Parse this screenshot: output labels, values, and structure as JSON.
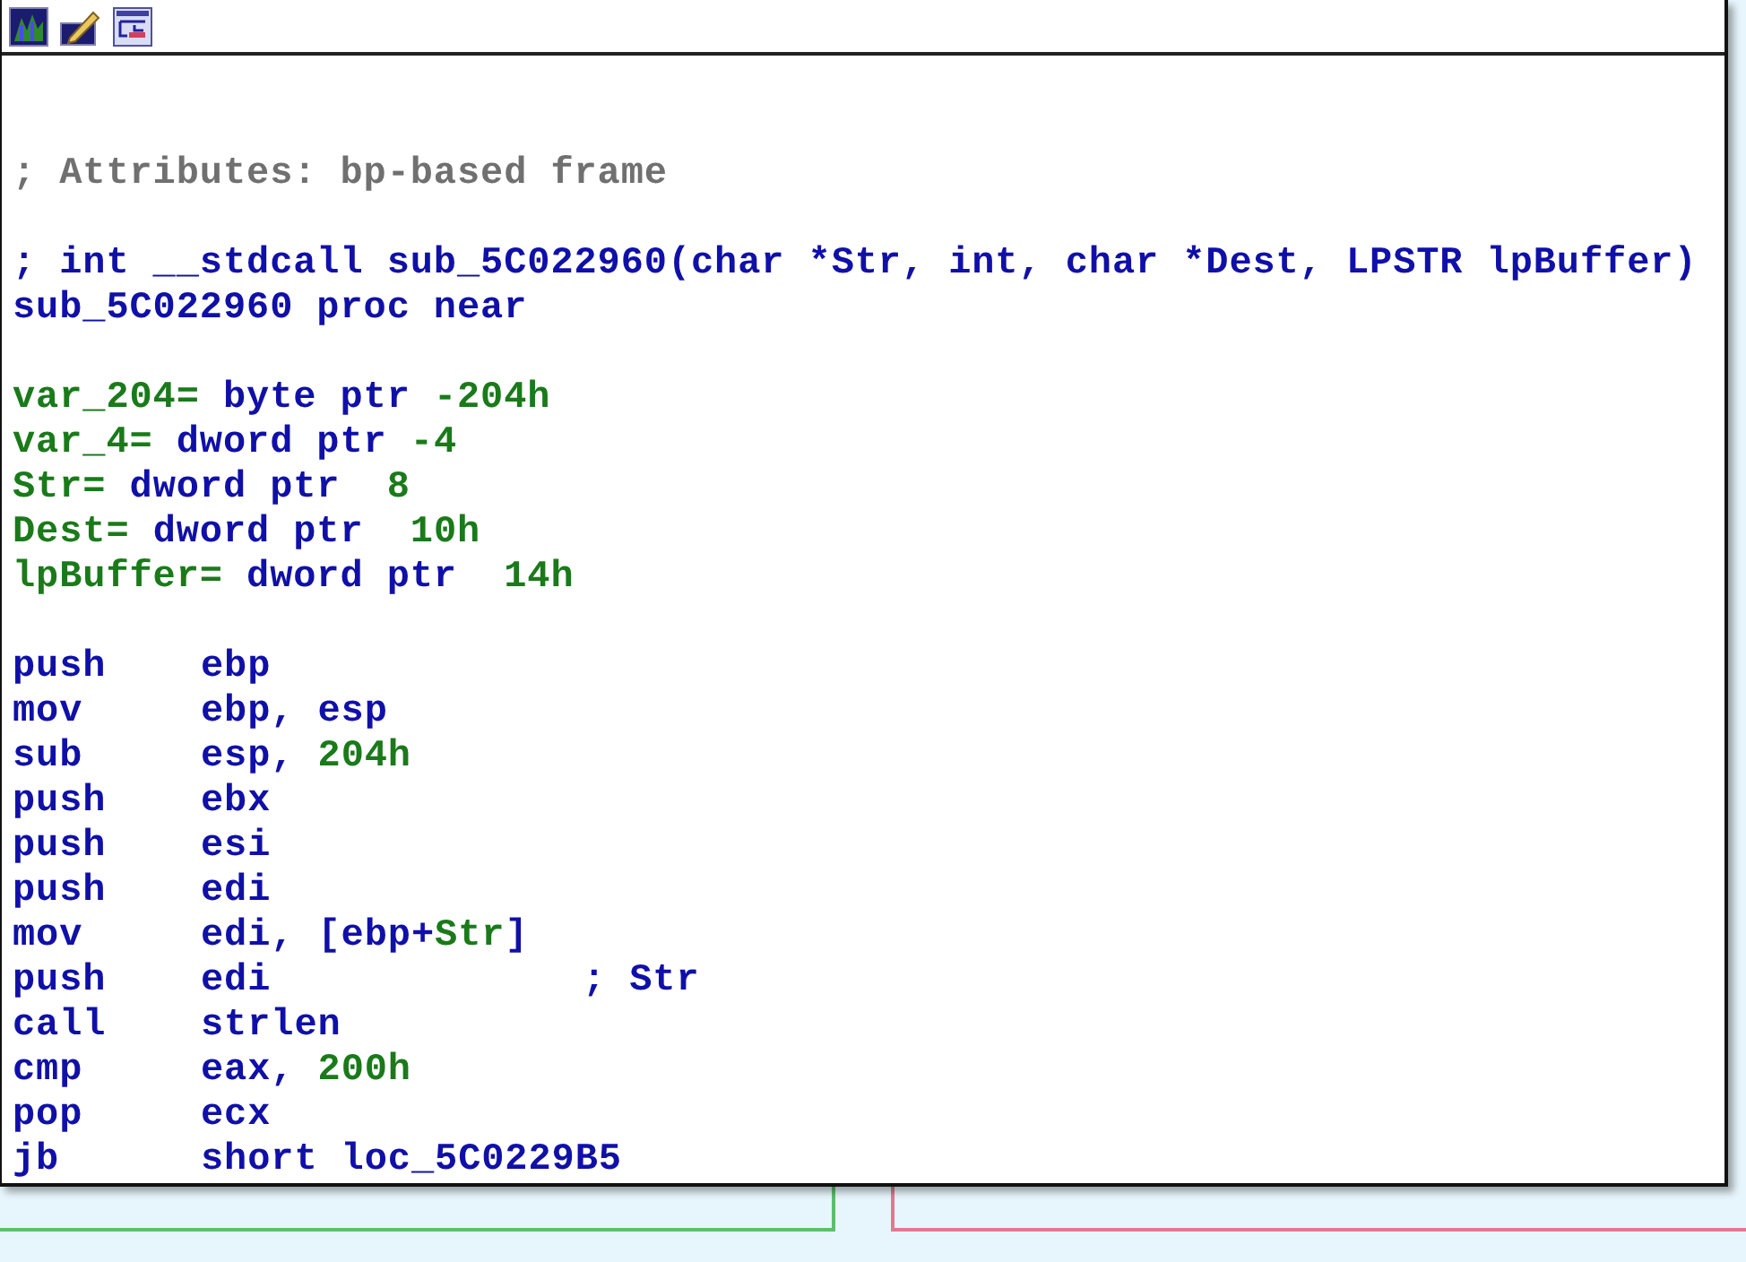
{
  "listing": [
    {
      "kind": "blank"
    },
    {
      "kind": "blank"
    },
    {
      "kind": "text",
      "segments": [
        {
          "text": "; Attributes: bp-based frame",
          "kind": "comment"
        }
      ]
    },
    {
      "kind": "blank"
    },
    {
      "kind": "text",
      "segments": [
        {
          "text": "; int __stdcall sub_5C022960(char *Str, int, char *Dest, LPSTR lpBuffer)",
          "kind": "code"
        }
      ]
    },
    {
      "kind": "text",
      "segments": [
        {
          "text": "sub_5C022960 proc near",
          "kind": "code"
        }
      ]
    },
    {
      "kind": "blank"
    },
    {
      "kind": "text",
      "segments": [
        {
          "text": "var_204=",
          "kind": "data"
        },
        {
          "text": " byte ptr ",
          "kind": "code"
        },
        {
          "text": "-204h",
          "kind": "data"
        }
      ]
    },
    {
      "kind": "text",
      "segments": [
        {
          "text": "var_4=",
          "kind": "data"
        },
        {
          "text": " dword ptr ",
          "kind": "code"
        },
        {
          "text": "-4",
          "kind": "data"
        }
      ]
    },
    {
      "kind": "text",
      "segments": [
        {
          "text": "Str=",
          "kind": "data"
        },
        {
          "text": " dword ptr  ",
          "kind": "code"
        },
        {
          "text": "8",
          "kind": "data"
        }
      ]
    },
    {
      "kind": "text",
      "segments": [
        {
          "text": "Dest=",
          "kind": "data"
        },
        {
          "text": " dword ptr  ",
          "kind": "code"
        },
        {
          "text": "10h",
          "kind": "data"
        }
      ]
    },
    {
      "kind": "text",
      "segments": [
        {
          "text": "lpBuffer=",
          "kind": "data"
        },
        {
          "text": " dword ptr  ",
          "kind": "code"
        },
        {
          "text": "14h",
          "kind": "data"
        }
      ]
    },
    {
      "kind": "blank"
    },
    {
      "kind": "instruction",
      "mnemonic": "push",
      "operands": [
        {
          "text": "ebp",
          "kind": "code"
        }
      ]
    },
    {
      "kind": "instruction",
      "mnemonic": "mov",
      "operands": [
        {
          "text": "ebp, esp",
          "kind": "code"
        }
      ]
    },
    {
      "kind": "instruction",
      "mnemonic": "sub",
      "operands": [
        {
          "text": "esp, ",
          "kind": "code"
        },
        {
          "text": "204h",
          "kind": "data"
        }
      ]
    },
    {
      "kind": "instruction",
      "mnemonic": "push",
      "operands": [
        {
          "text": "ebx",
          "kind": "code"
        }
      ]
    },
    {
      "kind": "instruction",
      "mnemonic": "push",
      "operands": [
        {
          "text": "esi",
          "kind": "code"
        }
      ]
    },
    {
      "kind": "instruction",
      "mnemonic": "push",
      "operands": [
        {
          "text": "edi",
          "kind": "code"
        }
      ]
    },
    {
      "kind": "instruction",
      "mnemonic": "mov",
      "operands": [
        {
          "text": "edi, [ebp+",
          "kind": "code"
        },
        {
          "text": "Str",
          "kind": "data"
        },
        {
          "text": "]",
          "kind": "code"
        }
      ]
    },
    {
      "kind": "instruction",
      "mnemonic": "push",
      "operands": [
        {
          "text": "edi",
          "kind": "code"
        }
      ],
      "comment": "; Str"
    },
    {
      "kind": "instruction",
      "mnemonic": "call",
      "operands": [
        {
          "text": "strlen",
          "kind": "code"
        }
      ]
    },
    {
      "kind": "instruction",
      "mnemonic": "cmp",
      "operands": [
        {
          "text": "eax, ",
          "kind": "code"
        },
        {
          "text": "200h",
          "kind": "data"
        }
      ]
    },
    {
      "kind": "instruction",
      "mnemonic": "pop",
      "operands": [
        {
          "text": "ecx",
          "kind": "code"
        }
      ]
    },
    {
      "kind": "instruction",
      "mnemonic": "jb",
      "operands": [
        {
          "text": "short loc_5C0229B5",
          "kind": "code"
        }
      ]
    }
  ]
}
